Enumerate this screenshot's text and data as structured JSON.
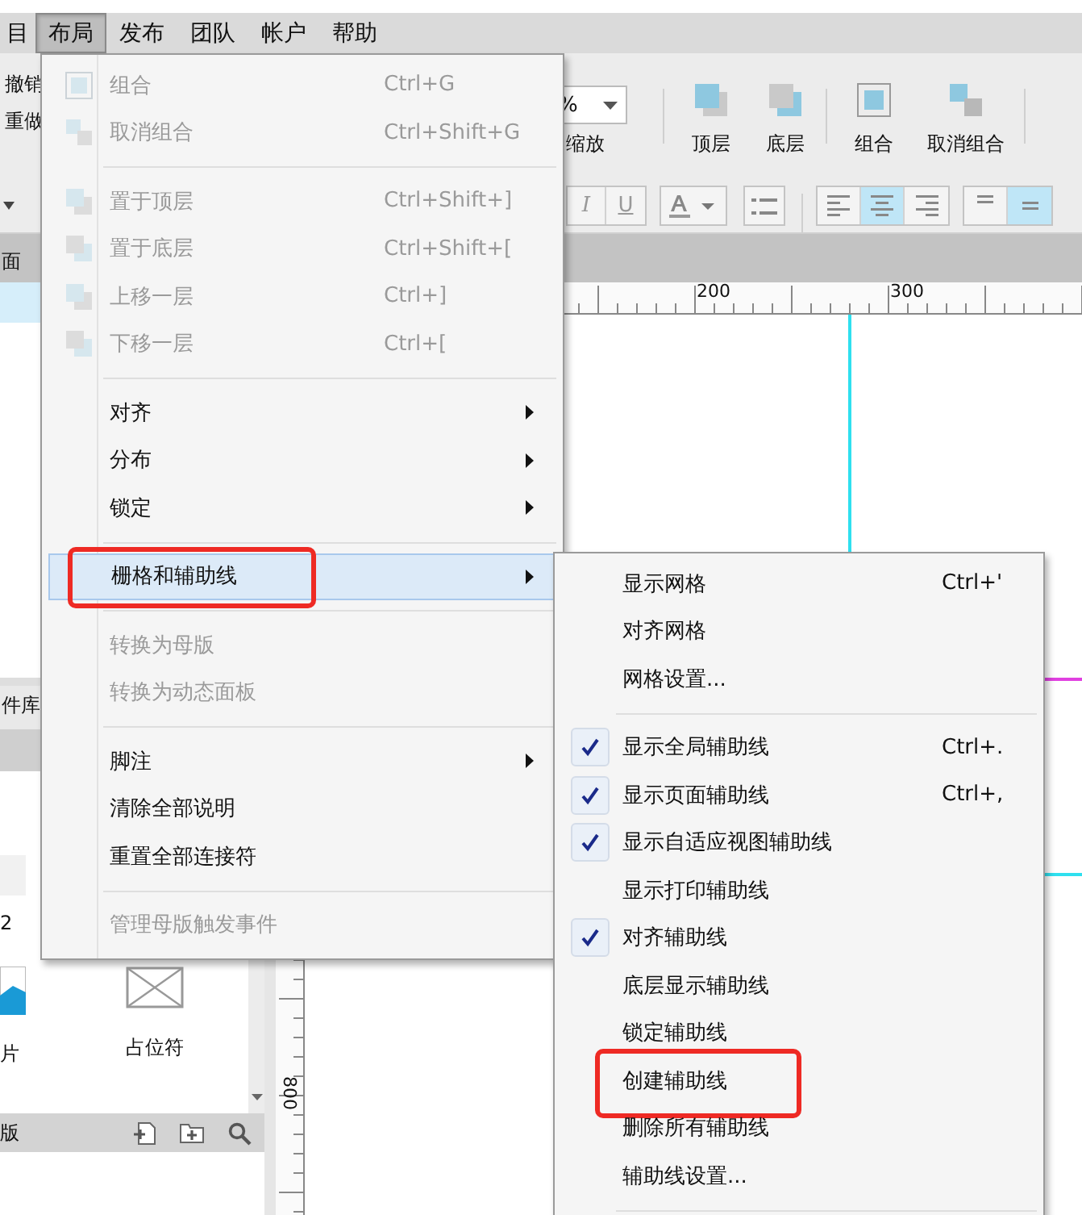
{
  "menubar": [
    {
      "label": "目",
      "selected": false
    },
    {
      "label": "布局",
      "selected": true
    },
    {
      "label": "发布",
      "selected": false
    },
    {
      "label": "团队",
      "selected": false
    },
    {
      "label": "帐户",
      "selected": false
    },
    {
      "label": "帮助",
      "selected": false
    }
  ],
  "toolbar": {
    "undo": "撤销",
    "redo": "重做",
    "zoom_value": "%",
    "zoom_label": "缩放",
    "buttons": [
      {
        "kind": "front",
        "label": "顶层"
      },
      {
        "kind": "back",
        "label": "底层"
      },
      {
        "kind": "group",
        "label": "组合"
      },
      {
        "kind": "ungroup",
        "label": "取消组合"
      }
    ]
  },
  "format_bar": {
    "italic": "I",
    "underline": "U",
    "align_group": [
      {
        "selected": false
      },
      {
        "selected": true
      },
      {
        "selected": false
      }
    ],
    "valign_group": [
      {
        "selected": false
      },
      {
        "selected": true
      }
    ]
  },
  "pages_panel": {
    "tab": "面"
  },
  "library_panel": {
    "tab": "件库",
    "item_label": "2",
    "widgets": [
      {
        "kind": "image",
        "label": "片"
      },
      {
        "kind": "placeholder",
        "label": "占位符"
      }
    ]
  },
  "masters_panel": {
    "tab": "版"
  },
  "ruler": {
    "top_labels": [
      "200",
      "300"
    ],
    "side_label": "800"
  },
  "menu": {
    "items": [
      {
        "kind": "group",
        "label": "组合",
        "shortcut": "Ctrl+G",
        "disabled": true
      },
      {
        "kind": "ungroup",
        "label": "取消组合",
        "shortcut": "Ctrl+Shift+G",
        "disabled": true
      },
      {
        "kind": "separator"
      },
      {
        "kind": "front",
        "label": "置于顶层",
        "shortcut": "Ctrl+Shift+]",
        "disabled": true
      },
      {
        "kind": "back",
        "label": "置于底层",
        "shortcut": "Ctrl+Shift+[",
        "disabled": true
      },
      {
        "kind": "forward",
        "label": "上移一层",
        "shortcut": "Ctrl+]",
        "disabled": true
      },
      {
        "kind": "backward",
        "label": "下移一层",
        "shortcut": "Ctrl+[",
        "disabled": true
      },
      {
        "kind": "separator"
      },
      {
        "kind": "plain",
        "label": "对齐",
        "submenu": true,
        "disabled": false,
        "selected": false
      },
      {
        "kind": "plain",
        "label": "分布",
        "submenu": true,
        "disabled": false,
        "selected": false
      },
      {
        "kind": "plain",
        "label": "锁定",
        "submenu": true,
        "disabled": false,
        "selected": false
      },
      {
        "kind": "separator"
      },
      {
        "kind": "plain",
        "label": "栅格和辅助线",
        "submenu": true,
        "disabled": false,
        "selected": true,
        "annotated": true
      },
      {
        "kind": "separator"
      },
      {
        "kind": "plain",
        "label": "转换为母版",
        "disabled": true
      },
      {
        "kind": "plain",
        "label": "转换为动态面板",
        "disabled": true
      },
      {
        "kind": "separator"
      },
      {
        "kind": "plain",
        "label": "脚注",
        "submenu": true,
        "disabled": false,
        "selected": false
      },
      {
        "kind": "plain",
        "label": "清除全部说明",
        "disabled": false,
        "selected": false
      },
      {
        "kind": "plain",
        "label": "重置全部连接符",
        "disabled": false,
        "selected": false
      },
      {
        "kind": "separator"
      },
      {
        "kind": "plain",
        "label": "管理母版触发事件",
        "disabled": true
      }
    ]
  },
  "submenu": {
    "items": [
      {
        "kind": "item",
        "label": "显示网格",
        "shortcut": "Ctrl+'",
        "checked": false
      },
      {
        "kind": "item",
        "label": "对齐网格",
        "checked": false
      },
      {
        "kind": "item",
        "label": "网格设置...",
        "checked": false
      },
      {
        "kind": "separator"
      },
      {
        "kind": "item",
        "label": "显示全局辅助线",
        "shortcut": "Ctrl+.",
        "checked": true
      },
      {
        "kind": "item",
        "label": "显示页面辅助线",
        "shortcut": "Ctrl+,",
        "checked": true
      },
      {
        "kind": "item",
        "label": "显示自适应视图辅助线",
        "checked": true
      },
      {
        "kind": "item",
        "label": "显示打印辅助线",
        "checked": false
      },
      {
        "kind": "item",
        "label": "对齐辅助线",
        "checked": true
      },
      {
        "kind": "item",
        "label": "底层显示辅助线",
        "checked": false
      },
      {
        "kind": "item",
        "label": "锁定辅助线",
        "checked": false
      },
      {
        "kind": "item",
        "label": "创建辅助线",
        "checked": false,
        "annotated": true
      },
      {
        "kind": "item",
        "label": "删除所有辅助线",
        "checked": false
      },
      {
        "kind": "item",
        "label": "辅助线设置...",
        "checked": false
      },
      {
        "kind": "separator"
      }
    ]
  }
}
